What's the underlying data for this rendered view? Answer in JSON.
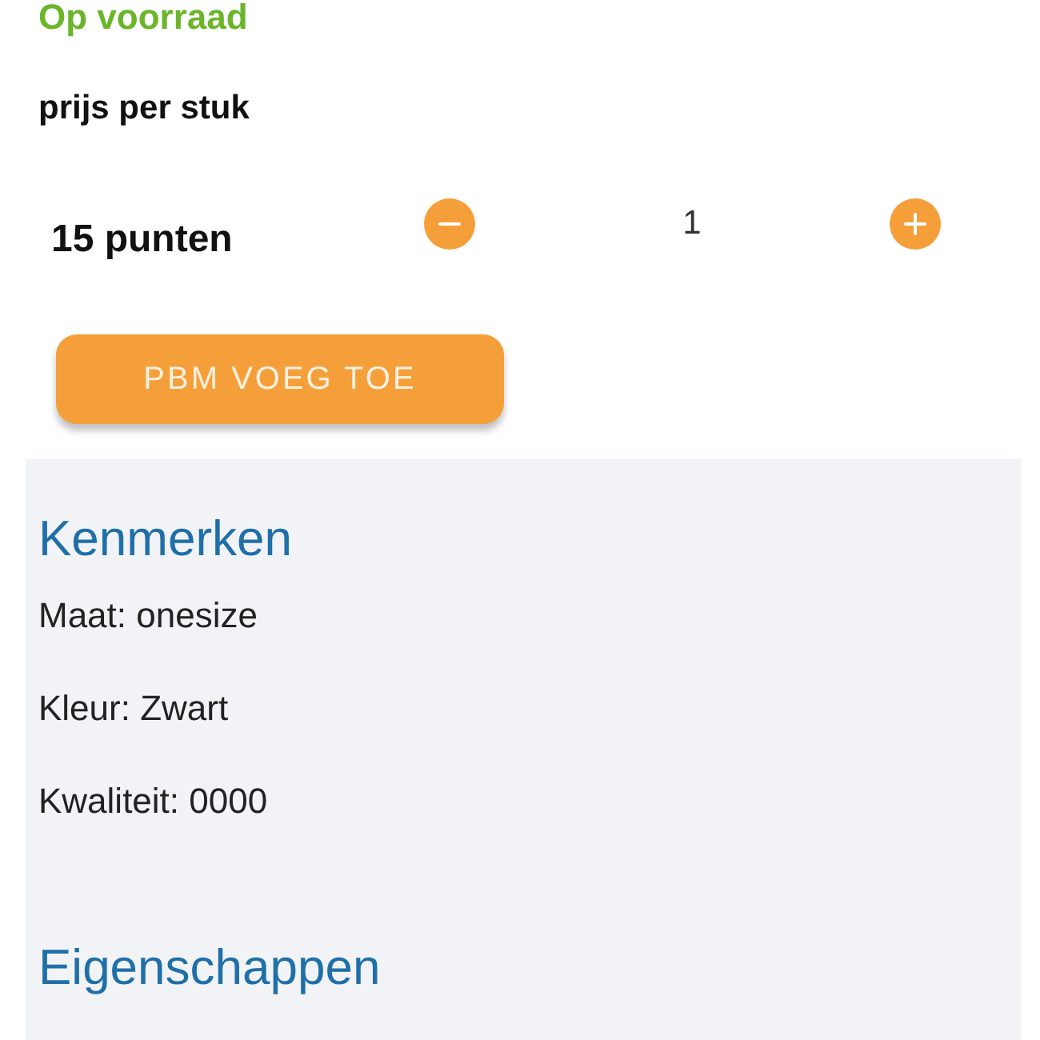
{
  "stock_status": "Op voorraad",
  "price": {
    "label": "prijs per stuk",
    "value": "15 punten"
  },
  "quantity": {
    "value": "1"
  },
  "add_button": "PBM VOEG TOE",
  "sections": [
    {
      "title": "Kenmerken",
      "items": [
        "Maat: onesize",
        "Kleur: Zwart",
        "Kwaliteit: 0000"
      ]
    },
    {
      "title": "Eigenschappen"
    }
  ]
}
